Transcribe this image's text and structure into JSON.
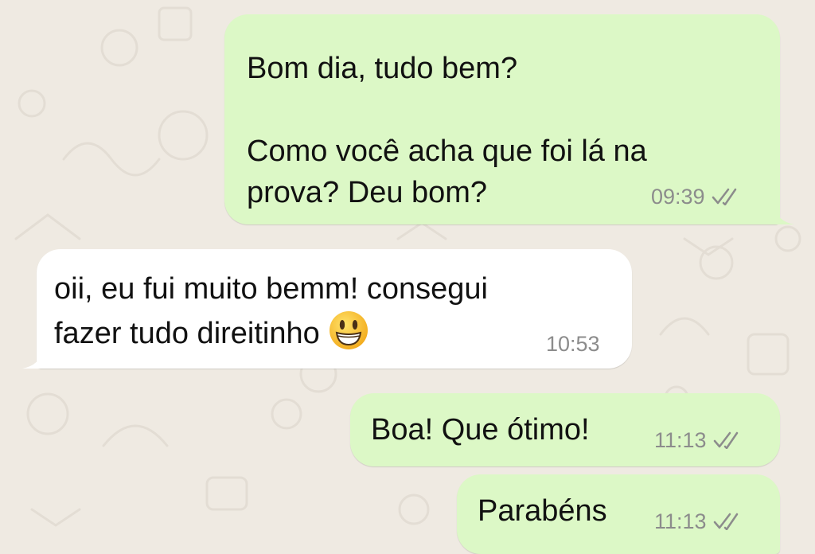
{
  "chat": {
    "messages": [
      {
        "direction": "outgoing",
        "text": "Bom dia, tudo bem?\n\nComo você acha que foi lá na\nprova? Deu bom?",
        "time": "09:39",
        "status_icon": "double-check-icon"
      },
      {
        "direction": "incoming",
        "text": "oii, eu fui muito bemm! consegui\nfazer tudo direitinho",
        "emoji": "grinning-face-emoji",
        "time": "10:53"
      },
      {
        "direction": "outgoing",
        "text": "Boa! Que ótimo!",
        "time": "11:13",
        "status_icon": "double-check-icon"
      },
      {
        "direction": "outgoing",
        "text": "Parabéns",
        "time": "11:13",
        "status_icon": "double-check-icon"
      }
    ]
  },
  "colors": {
    "background": "#efeae2",
    "outgoing_bubble": "#dcf8c6",
    "incoming_bubble": "#ffffff",
    "timestamp": "#8c8c8c"
  }
}
